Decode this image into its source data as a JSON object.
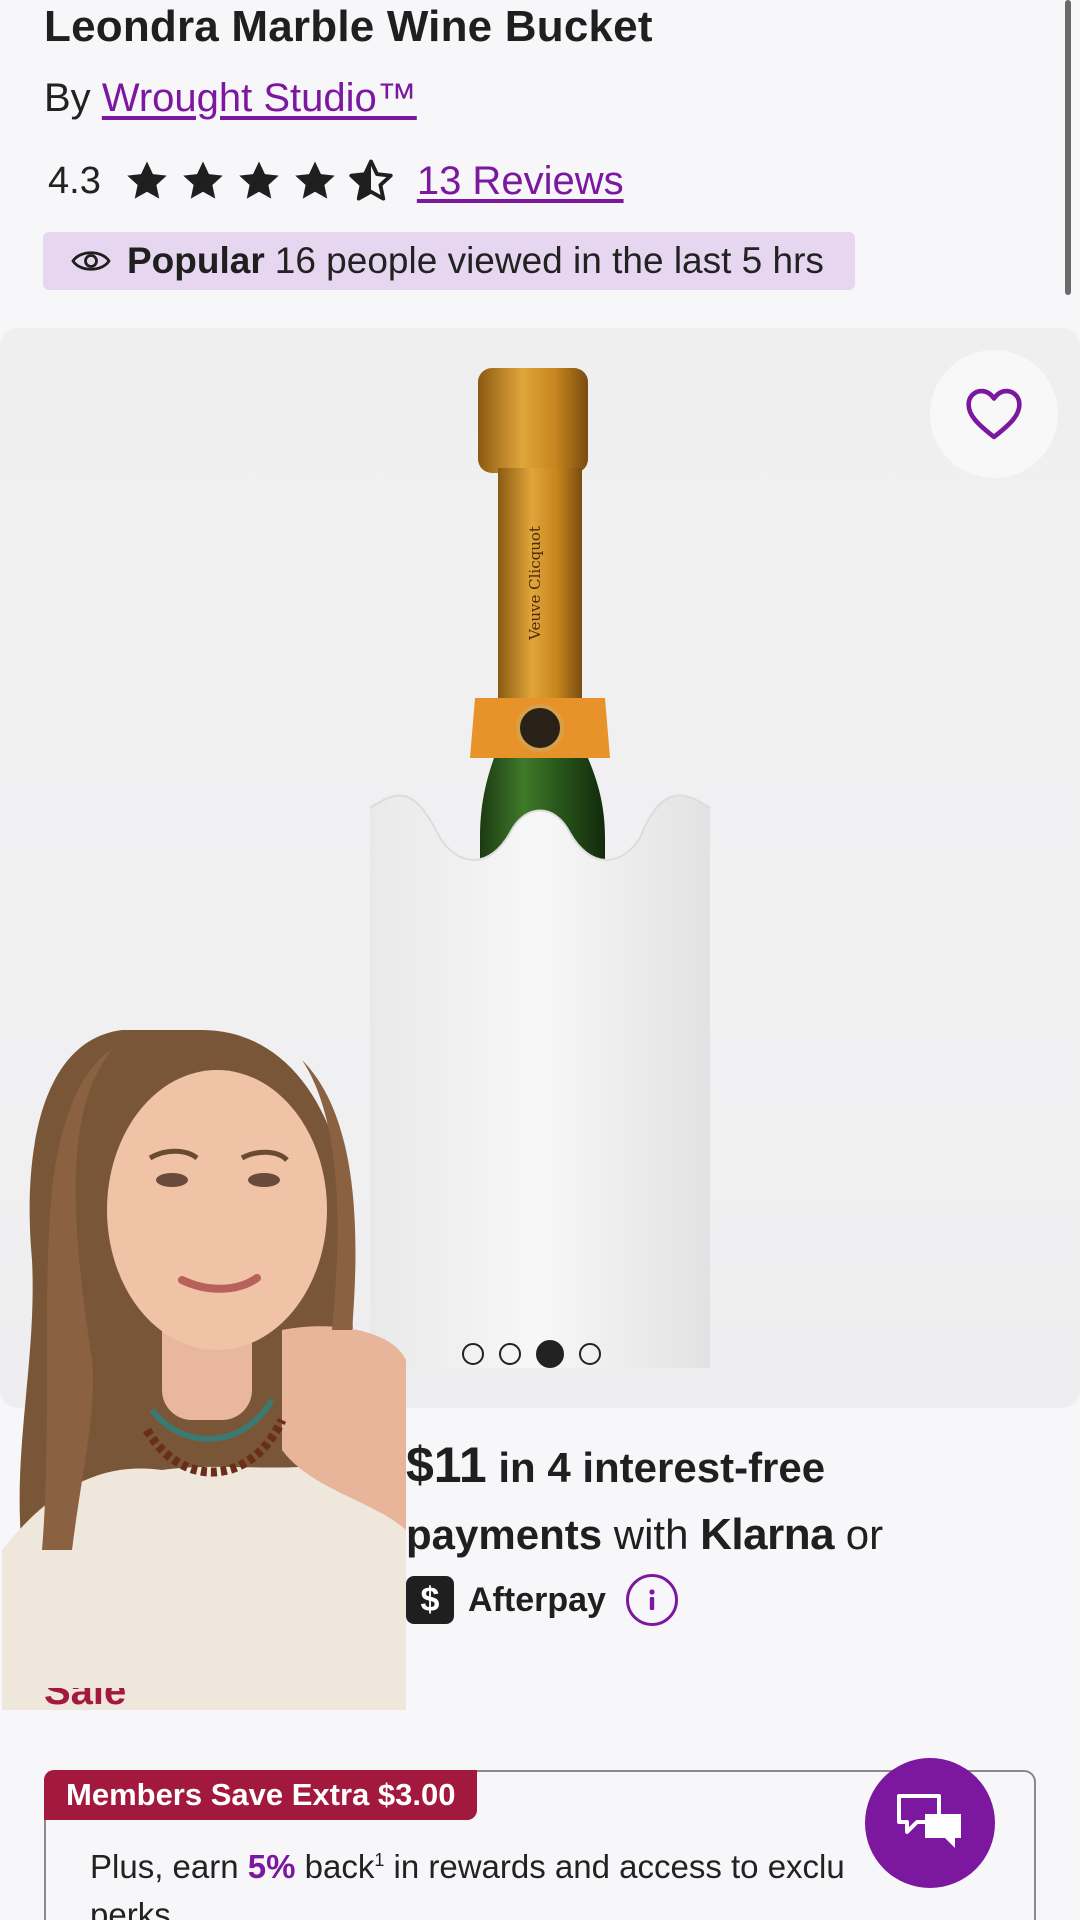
{
  "product": {
    "title": "Leondra Marble Wine Bucket",
    "by_prefix": "By",
    "brand": "Wrought Studio™",
    "rating": "4.3",
    "rating_value": 4.3,
    "rating_max": 5,
    "reviews_link": "13 Reviews"
  },
  "popularity": {
    "icon": "eye-icon",
    "label": "Popular",
    "text": "16 people viewed in the last 5 hrs"
  },
  "gallery": {
    "favorite_icon": "heart-outline-icon",
    "slide_count": 4,
    "active_slide": 3,
    "bottle_label": "Veuve Clicquot"
  },
  "payments": {
    "amount": "$11",
    "line1_rest": " in 4 interest-free",
    "line2_bold": "payments",
    "line2_with": " with ",
    "klarna": "Klarna",
    "line2_or": " or",
    "afterpay_icon_glyph": "$",
    "afterpay": "Afterpay",
    "info_icon": "info-icon"
  },
  "sale_partial": "Sale",
  "members": {
    "tag": "Members Save Extra $3.00",
    "text_prefix": "Plus, earn ",
    "percent": "5%",
    "text_mid": " back",
    "sup": "1",
    "text_suffix": " in rewards and access to exclu",
    "text_line2": "perks"
  },
  "chat": {
    "icon": "chat-bubbles-icon"
  },
  "colors": {
    "accent_purple": "#7b189f",
    "sale_red": "#a3183d",
    "badge_lavender": "#e7d6ef",
    "text_dark": "#1f1f1f"
  }
}
